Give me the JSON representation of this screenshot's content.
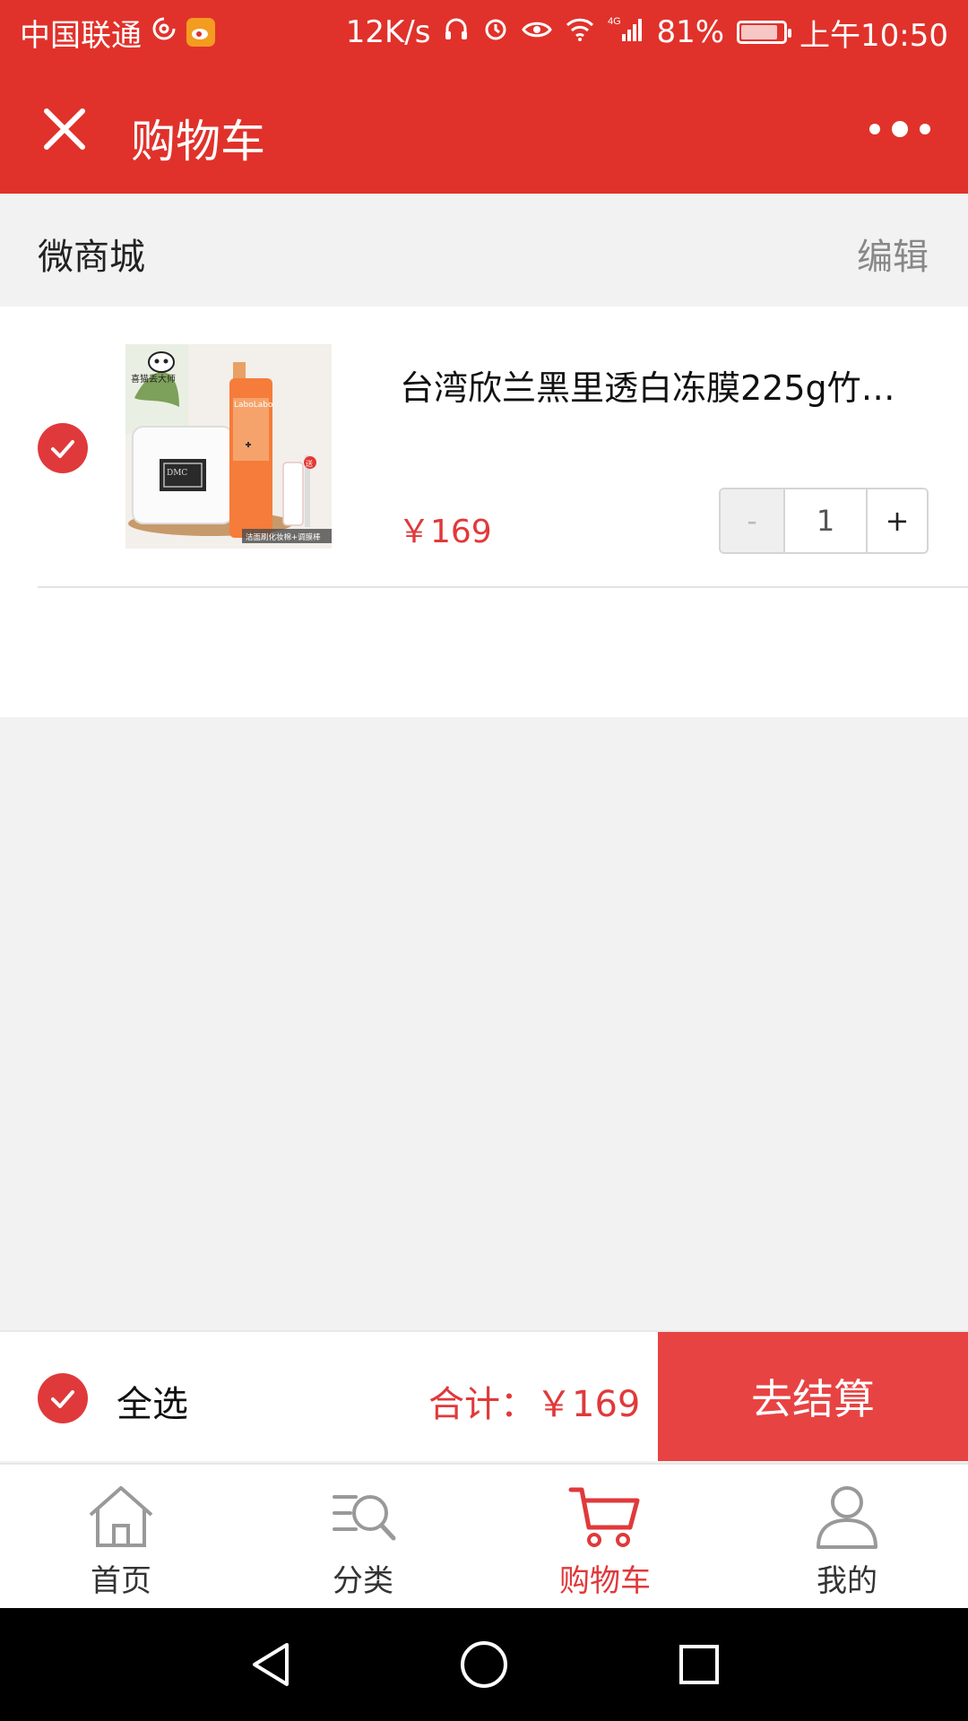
{
  "status_bar": {
    "carrier": "中国联通",
    "net_speed": "12K/s",
    "network": "4G",
    "battery": "81%",
    "time": "上午10:50"
  },
  "nav": {
    "title": "购物车",
    "close_icon": "close-icon",
    "more_icon": "more-icon"
  },
  "shop": {
    "name": "微商城",
    "edit_label": "编辑"
  },
  "cart": {
    "items": [
      {
        "selected": true,
        "title": "台湾欣兰黑里透白冻膜225g竹炭…",
        "price": "￥169",
        "quantity": "1",
        "minus_label": "-",
        "plus_label": "+",
        "image": {
          "brand_text": "LaboLabo",
          "jar_label": "DMC",
          "badge": "送",
          "caption": "洁面刷化妆棉+调膜棒",
          "logo_text": "喜猫丢大师"
        }
      }
    ]
  },
  "checkout": {
    "select_all_label": "全选",
    "total_label": "合计：￥169",
    "button_label": "去结算"
  },
  "tabbar": {
    "tabs": [
      {
        "label": "首页",
        "icon": "home-icon"
      },
      {
        "label": "分类",
        "icon": "category-search-icon"
      },
      {
        "label": "购物车",
        "icon": "cart-icon",
        "active": true
      },
      {
        "label": "我的",
        "icon": "user-icon"
      }
    ]
  },
  "colors": {
    "primary": "#e0322b",
    "accent": "#e0393b",
    "background": "#f2f2f2"
  }
}
